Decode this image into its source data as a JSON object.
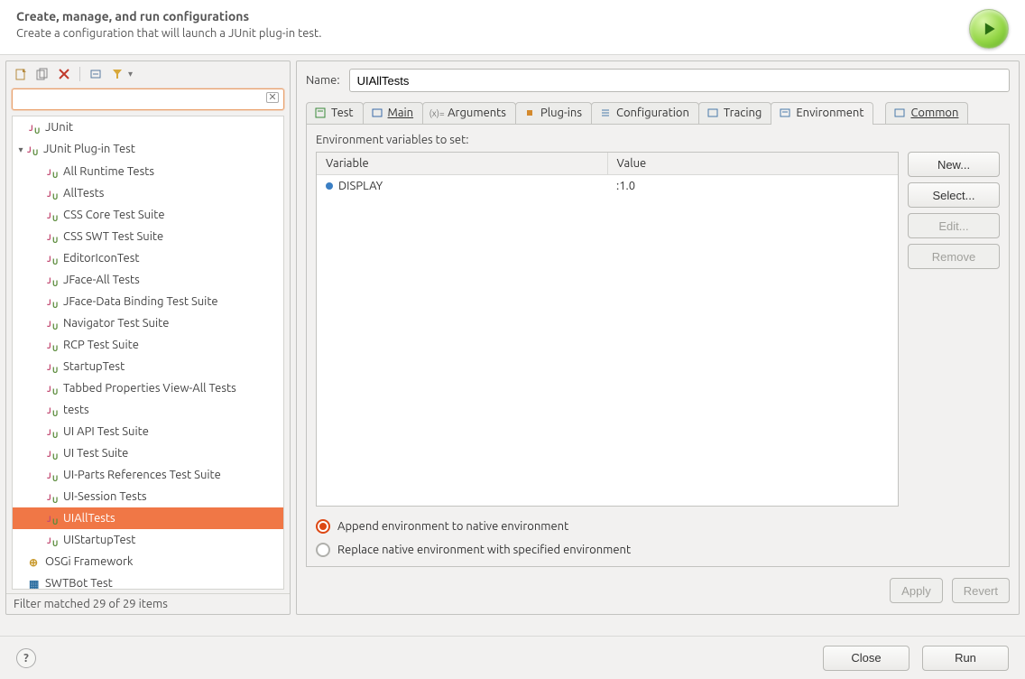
{
  "header": {
    "title": "Create, manage, and run configurations",
    "subtitle": "Create a configuration that will launch a JUnit plug-in test."
  },
  "sidebar": {
    "filter_placeholder": "",
    "tree": {
      "junit": "JUnit",
      "junit_plugin": "JUnit Plug-in Test",
      "children": [
        "All Runtime Tests",
        "AllTests",
        "CSS Core Test Suite",
        "CSS SWT Test Suite",
        "EditorIconTest",
        "JFace-All Tests",
        "JFace-Data Binding Test Suite",
        "Navigator Test Suite",
        "RCP Test Suite",
        "StartupTest",
        "Tabbed Properties View-All Tests",
        "tests",
        "UI API Test Suite",
        "UI Test Suite",
        "UI-Parts References Test Suite",
        "UI-Session Tests",
        "UIAllTests",
        "UIStartupTest"
      ],
      "osgi": "OSGi Framework",
      "swtbot": "SWTBot Test"
    },
    "filter_status": "Filter matched 29 of 29 items"
  },
  "main": {
    "name_label": "Name:",
    "name_value": "UIAllTests",
    "tabs": {
      "test": "Test",
      "main": "Main",
      "arguments": "Arguments",
      "plugins": "Plug-ins",
      "configuration": "Configuration",
      "tracing": "Tracing",
      "environment": "Environment",
      "common": "Common"
    },
    "env": {
      "title": "Environment variables to set:",
      "col_variable": "Variable",
      "col_value": "Value",
      "rows": [
        {
          "name": "DISPLAY",
          "value": ":1.0"
        }
      ],
      "buttons": {
        "new": "New...",
        "select": "Select...",
        "edit": "Edit...",
        "remove": "Remove"
      },
      "radio_append": "Append environment to native environment",
      "radio_replace": "Replace native environment with specified environment"
    },
    "apply": "Apply",
    "revert": "Revert"
  },
  "footer": {
    "close": "Close",
    "run": "Run"
  }
}
